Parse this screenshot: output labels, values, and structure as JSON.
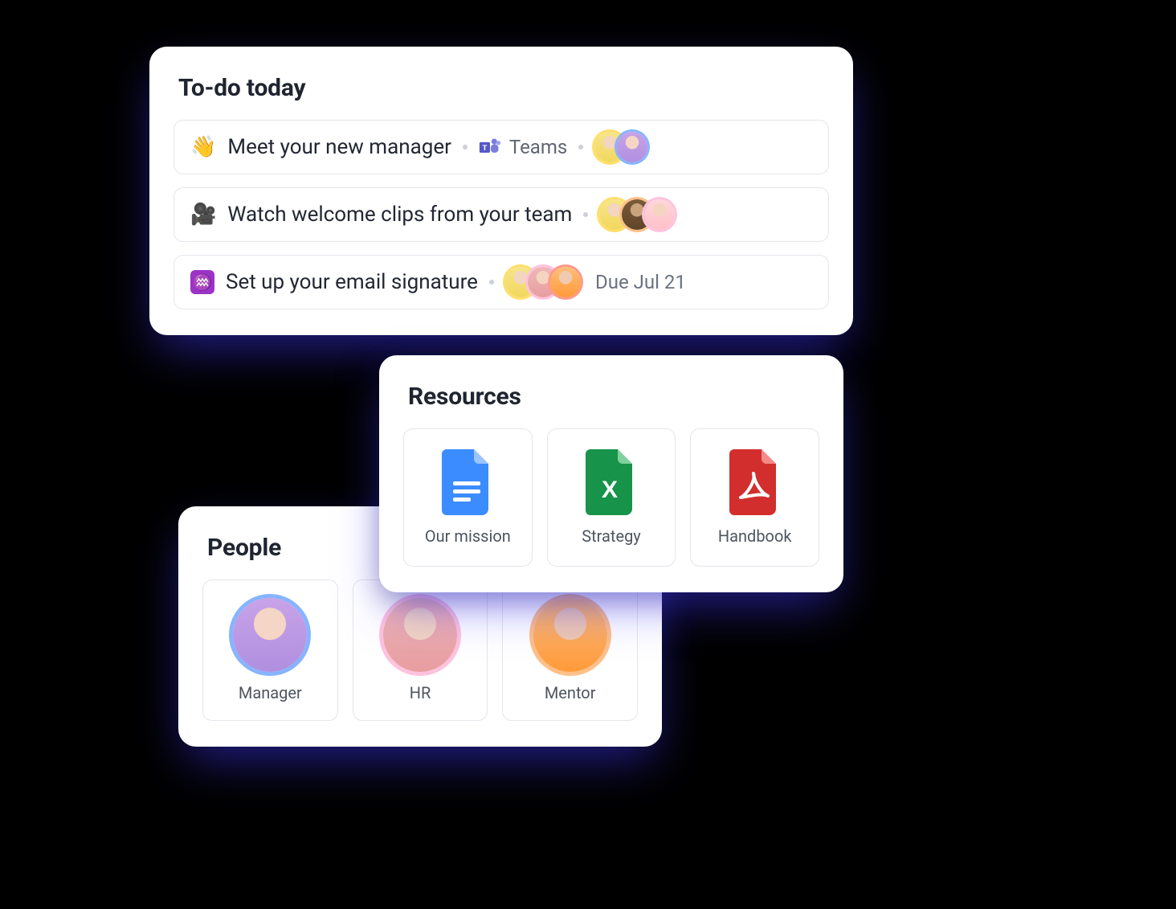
{
  "todo": {
    "title": "To-do today",
    "items": [
      {
        "emoji": "👋",
        "title": "Meet your new manager",
        "app": {
          "name": "Teams",
          "icon": "teams-icon"
        },
        "avatars": 2,
        "due": null
      },
      {
        "emoji": "🎥",
        "title": "Watch welcome clips from your team",
        "app": null,
        "avatars": 3,
        "due": null
      },
      {
        "emoji": "♒",
        "title": "Set up your email signature",
        "app": null,
        "avatars": 3,
        "due": "Due Jul 21"
      }
    ]
  },
  "resources": {
    "title": "Resources",
    "items": [
      {
        "label": "Our mission",
        "kind": "gdoc"
      },
      {
        "label": "Strategy",
        "kind": "xlsx"
      },
      {
        "label": "Handbook",
        "kind": "pdf"
      }
    ]
  },
  "people": {
    "title": "People",
    "items": [
      {
        "label": "Manager",
        "ring": "blue"
      },
      {
        "label": "HR",
        "ring": "pink"
      },
      {
        "label": "Mentor",
        "ring": "orange"
      }
    ]
  }
}
